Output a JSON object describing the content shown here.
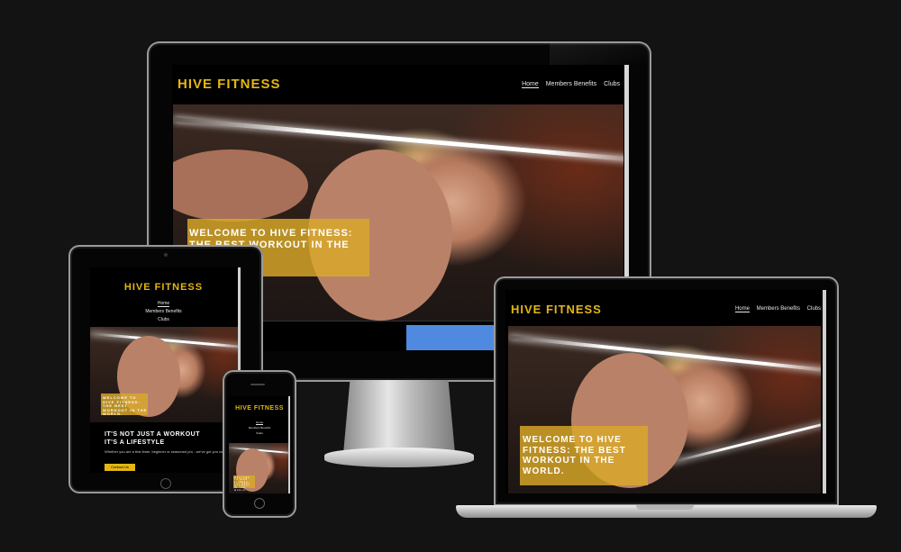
{
  "site": {
    "logo": "HIVE FITNESS",
    "nav": [
      "Home",
      "Members Benefits",
      "Clubs"
    ],
    "hero_text_desktop": "WELCOME TO HIVE FITNESS: THE BEST WORKOUT IN THE",
    "hero_text_laptop": "WELCOME TO HIVE FITNESS: THE BEST WORKOUT IN THE WORLD.",
    "hero_text_tablet": "WELCOME TO HIVE FITNESS: THE BEST WORKOUT IN THE WORLD.",
    "hero_text_phone": "WELCOME TO HIVE FITNESS: THE BEST WORKOUT IN THE WORLD.",
    "tagline": "IT'S NOT JUST A WORKOUT IT'S A LIFESTYLE",
    "subtext": "Whether you are a first timer, beginner or seasoned pro - we've got you covered.",
    "cta": "Contact Us"
  },
  "colors": {
    "accent": "#e2b714",
    "background": "#131313"
  }
}
